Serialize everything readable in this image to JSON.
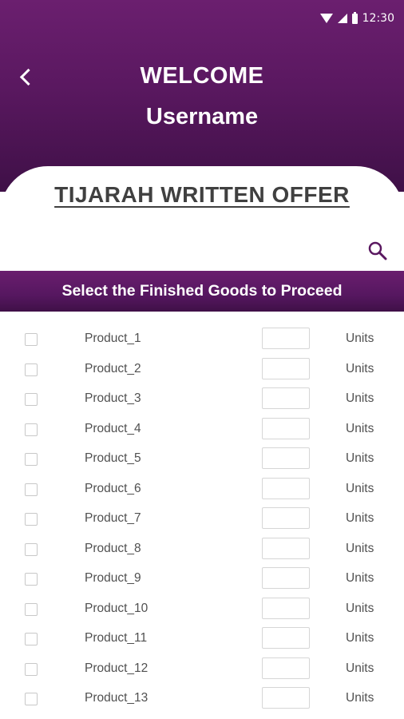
{
  "status_bar": {
    "time": "12:30",
    "icons": [
      "wifi-icon",
      "cellular-signal-icon",
      "battery-icon"
    ]
  },
  "header": {
    "back_icon": "chevron-left-icon",
    "welcome": "WELCOME",
    "username": "Username"
  },
  "offer": {
    "title": "TIJARAH WRITTEN OFFER",
    "search_icon": "search-icon"
  },
  "banner": {
    "text": "Select the Finished Goods to Proceed"
  },
  "products": [
    {
      "name": "Product_1",
      "units": "Units",
      "quantity": ""
    },
    {
      "name": "Product_2",
      "units": "Units",
      "quantity": ""
    },
    {
      "name": "Product_3",
      "units": "Units",
      "quantity": ""
    },
    {
      "name": "Product_4",
      "units": "Units",
      "quantity": ""
    },
    {
      "name": "Product_5",
      "units": "Units",
      "quantity": ""
    },
    {
      "name": "Product_6",
      "units": "Units",
      "quantity": ""
    },
    {
      "name": "Product_7",
      "units": "Units",
      "quantity": ""
    },
    {
      "name": "Product_8",
      "units": "Units",
      "quantity": ""
    },
    {
      "name": "Product_9",
      "units": "Units",
      "quantity": ""
    },
    {
      "name": "Product_10",
      "units": "Units",
      "quantity": ""
    },
    {
      "name": "Product_11",
      "units": "Units",
      "quantity": ""
    },
    {
      "name": "Product_12",
      "units": "Units",
      "quantity": ""
    },
    {
      "name": "Product_13",
      "units": "Units",
      "quantity": ""
    }
  ],
  "colors": {
    "primary": "#5a1860",
    "primary_dark": "#3f1047",
    "text": "#505050",
    "title": "#404040"
  }
}
